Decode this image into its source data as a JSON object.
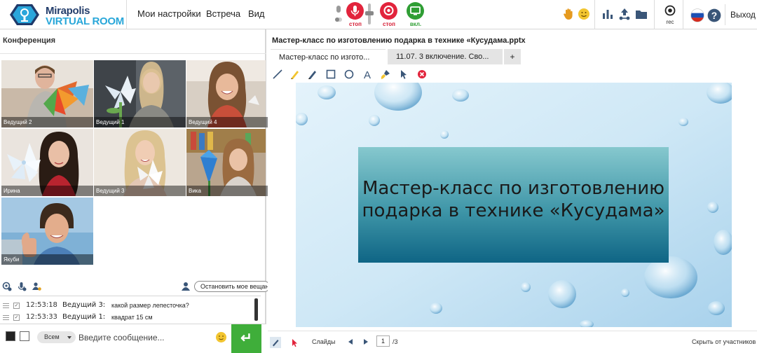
{
  "app": {
    "brand_line1": "Mirapolis",
    "brand_line2": "VIRTUAL ROOM"
  },
  "menu": {
    "settings": "Мои настройки",
    "meeting": "Встреча",
    "view": "Вид"
  },
  "controls": {
    "mic_label": "стоп",
    "camera_label": "стоп",
    "screen_label": "вкл.",
    "rec_label": "rec",
    "exit_label": "Выход"
  },
  "icons": {
    "hand": "raise-hand-icon",
    "emoji": "emoji-icon",
    "stats": "statistics-icon",
    "share": "share-icon",
    "folder": "folder-icon",
    "rec": "record-icon",
    "flag": "russia-flag-icon",
    "help": "help-icon"
  },
  "colors": {
    "brand_dark": "#233d6b",
    "brand_light": "#29a7d9",
    "stop_red": "#d61e35",
    "screen_green": "#3fae3a",
    "send_green": "#3fae3a"
  },
  "conference": {
    "title": "Конференция",
    "participants": [
      {
        "name": "Ведущий 2"
      },
      {
        "name": "Ведущий 1"
      },
      {
        "name": "Ведущий 4"
      },
      {
        "name": "Ирина"
      },
      {
        "name": "Ведущий 3"
      },
      {
        "name": "Вика"
      },
      {
        "name": "Якуби"
      }
    ],
    "stop_broadcast": "Остановить мое вещание"
  },
  "chat": {
    "messages": [
      {
        "time": "12:53:18",
        "author": "Ведущий 3:",
        "text": "какой размер лепесточка?"
      },
      {
        "time": "12:53:33",
        "author": "Ведущий 1:",
        "text": "квадрат 15 см"
      }
    ],
    "recipient": "Всем",
    "input_placeholder": "Введите сообщение...",
    "send_symbol": "↵"
  },
  "document": {
    "title": "Мастер-класс по изготовлению подарка в технике «Кусудама.pptx",
    "tabs": [
      {
        "label": "Мастер-класс по изгото...",
        "active": true
      },
      {
        "label": "11.07. 3 включение. Сво...",
        "active": false
      }
    ],
    "add_tab": "+",
    "slide_title": "Мастер-класс по изготовлению подарка в технике «Кусудама»",
    "slides_label": "Слайды",
    "current_page": "1",
    "total_pages": "/3",
    "hide_label": "Скрыть от участников"
  }
}
